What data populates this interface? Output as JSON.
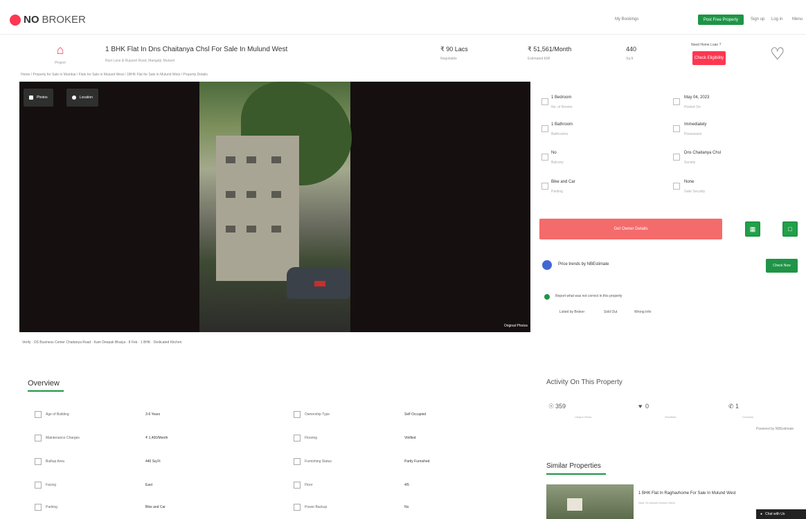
{
  "brand": {
    "name_bold": "NO",
    "name_light": "BROKER",
    "accent": "#fd3752",
    "green": "#1f9447"
  },
  "header": {
    "links": [
      "My Bookings",
      "",
      "Post Free Property",
      "Sign up",
      "Log in",
      "Menu"
    ],
    "post_label": "Post Free Property"
  },
  "listing": {
    "home_caption": "Project",
    "title": "1 BHK Flat In Dns Chaitanya Chsl For Sale In Mulund West",
    "subtitle": "Ravi Lane & Ruparel Road, Mangalji, Mulund",
    "price": "₹ 90 Lacs",
    "price_sub": "Negotiable",
    "emi": "₹ 51,561/Month",
    "emi_sub": "Estimated EMI",
    "area": "440",
    "area_sub": "Sq.ft",
    "contact_caption": "Need Home Loan ?",
    "contact_btn": "Check Eligibility"
  },
  "breadcrumb": "Home / Property for Sale in Mumbai / Flats for Sale in Mulund West / 1BHK Flat for Sale in Mulund West / Property Details",
  "gallery": {
    "photos_btn": "Photos",
    "location_btn": "Location",
    "orig_label": "Original Photos"
  },
  "meta": "Verify  ·  DS Business Center Chaitanya Road  ·  Kam Deepak Bhaiya  ·  8 Feb  ·  1 BHK  ·  Dedicated Kitchen",
  "overview": {
    "title": "Overview",
    "rows": [
      {
        "l1": "Age of Building",
        "v1": "3-6 Years",
        "l2": "Ownership Type",
        "v2": "Self Occupied"
      },
      {
        "l1": "Maintenance Charges",
        "v1": "₹ 1,400/Month",
        "l2": "Flooring",
        "v2": "Vitrified"
      },
      {
        "l1": "Builtup Area",
        "v1": "440 Sq.Ft",
        "l2": "Furnishing Status",
        "v2": "Partly Furnished"
      },
      {
        "l1": "Facing",
        "v1": "East",
        "l2": "Floor",
        "v2": "4/5"
      },
      {
        "l1": "Parking",
        "v1": "Bike and Car",
        "l2": "Power Backup",
        "v2": "No"
      }
    ]
  },
  "specs": [
    {
      "v": "1 Bedroom",
      "s": "No. of Rooms"
    },
    {
      "v": "May 04, 2023",
      "s": "Posted On"
    },
    {
      "v": "1 Bathroom",
      "s": "Bathrooms"
    },
    {
      "v": "Immediately",
      "s": "Possession"
    },
    {
      "v": "No",
      "s": "Balcony"
    },
    {
      "v": "Dns Chaitanya Chsl",
      "s": "Society"
    },
    {
      "v": "Bike and Car",
      "s": "Parking"
    },
    {
      "v": "None",
      "s": "Gate Security"
    }
  ],
  "actions": {
    "owner_btn": "Get Owner Details",
    "cal_icon": "calendar-icon",
    "chat_icon": "chat-icon"
  },
  "price_trends": {
    "label": "Price trends by NBEstimate",
    "btn": "Check Now"
  },
  "report": {
    "label": "Report what was not correct in this property",
    "options": [
      "Listed by Broker",
      "Sold Out",
      "Wrong Info"
    ]
  },
  "activity": {
    "title": "Activity On This Property",
    "items": [
      {
        "v": "359",
        "l": "Unique Views"
      },
      {
        "v": "0",
        "l": "Shortlists"
      },
      {
        "v": "1",
        "l": "Contacts"
      }
    ],
    "powered": "Powered by NBEstimate"
  },
  "similar": {
    "title": "Similar Properties",
    "item_title": "1 BHK Flat In Raghavhome For Sale In Mulund West",
    "item_sub": "Near Gk Market Mulund West"
  },
  "chat": {
    "label": "Chat with Us"
  }
}
